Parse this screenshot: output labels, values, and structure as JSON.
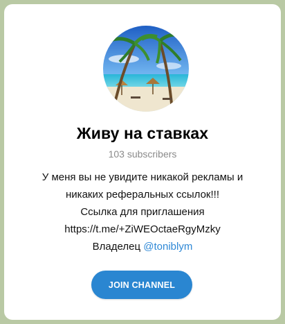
{
  "channel": {
    "title": "Живу на ставках",
    "subscribers": "103 subscribers",
    "avatar_icon": "beach-palm-avatar"
  },
  "description": {
    "lines": [
      "У меня вы не увидите никакой рекламы и",
      "никаких реферальных ссылок!!!",
      "Ссылка для приглашения",
      "https://t.me/+ZiWEOctaeRgyMzky"
    ],
    "owner_label": "Владелец ",
    "owner_mention": "@toniblym"
  },
  "actions": {
    "join_label": "JOIN CHANNEL"
  },
  "colors": {
    "accent": "#2a86d1",
    "link": "#2e88d6",
    "background": "#b9c9a4"
  }
}
